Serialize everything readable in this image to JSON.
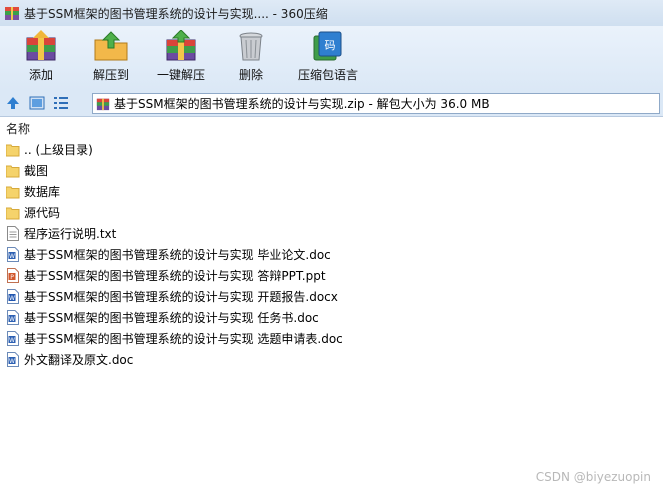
{
  "window": {
    "title": "基于SSM框架的图书管理系统的设计与实现.... - 360压缩"
  },
  "toolbar": {
    "buttons": [
      {
        "label": "添加",
        "icon": "add-archive-icon"
      },
      {
        "label": "解压到",
        "icon": "extract-to-icon"
      },
      {
        "label": "一键解压",
        "icon": "one-click-extract-icon"
      },
      {
        "label": "删除",
        "icon": "trash-icon"
      },
      {
        "label": "压缩包语言",
        "icon": "archive-language-icon"
      }
    ]
  },
  "address": {
    "path": "基于SSM框架的图书管理系统的设计与实现.zip - 解包大小为 36.0 MB"
  },
  "columns": {
    "name": "名称"
  },
  "files": [
    {
      "name": ".. (上级目录)",
      "type": "folder"
    },
    {
      "name": "截图",
      "type": "folder"
    },
    {
      "name": "数据库",
      "type": "folder"
    },
    {
      "name": "源代码",
      "type": "folder"
    },
    {
      "name": "程序运行说明.txt",
      "type": "txt"
    },
    {
      "name": "基于SSM框架的图书管理系统的设计与实现 毕业论文.doc",
      "type": "doc"
    },
    {
      "name": "基于SSM框架的图书管理系统的设计与实现 答辩PPT.ppt",
      "type": "ppt"
    },
    {
      "name": "基于SSM框架的图书管理系统的设计与实现 开题报告.docx",
      "type": "docx"
    },
    {
      "name": "基于SSM框架的图书管理系统的设计与实现 任务书.doc",
      "type": "doc"
    },
    {
      "name": "基于SSM框架的图书管理系统的设计与实现 选题申请表.doc",
      "type": "doc"
    },
    {
      "name": "外文翻译及原文.doc",
      "type": "doc"
    }
  ],
  "watermark": "CSDN @biyezuopin"
}
